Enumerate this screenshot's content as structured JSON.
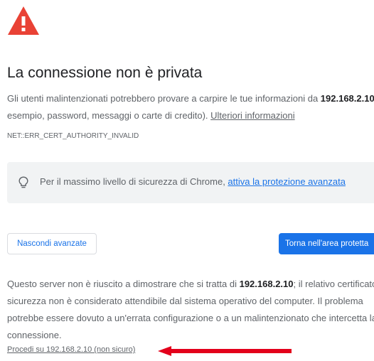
{
  "page": {
    "title": "La connessione non è privata",
    "intro": {
      "before": "Gli utenti malintenzionati potrebbero provare a carpire le tue informazioni da ",
      "host": "192.168.2.10",
      "after": " (ad esempio, password, messaggi o carte di credito). ",
      "learn_more": "Ulteriori informazioni"
    },
    "error_code": "NET::ERR_CERT_AUTHORITY_INVALID",
    "tip": {
      "text": "Per il massimo livello di sicurezza di Chrome, ",
      "link": "attiva la protezione avanzata"
    },
    "buttons": {
      "advanced": "Nascondi avanzate",
      "back": "Torna nell'area protetta"
    },
    "details": {
      "before": "Questo server non è riuscito a dimostrare che si tratta di ",
      "host": "192.168.2.10",
      "after": "; il relativo certificato di sicurezza non è considerato attendibile dal sistema operativo del computer. Il problema potrebbe essere dovuto a un'errata configurazione o a un malintenzionato che intercetta la connessione."
    },
    "proceed_link": "Procedi su 192.168.2.10 (non sicuro)"
  },
  "icons": {
    "warning": "warning-triangle-icon",
    "bulb": "lightbulb-icon",
    "annotation": "red-arrow-annotation"
  },
  "colors": {
    "warning_red": "#e94235",
    "accent_blue": "#1a73e8",
    "annotation_red": "#e3001b"
  }
}
